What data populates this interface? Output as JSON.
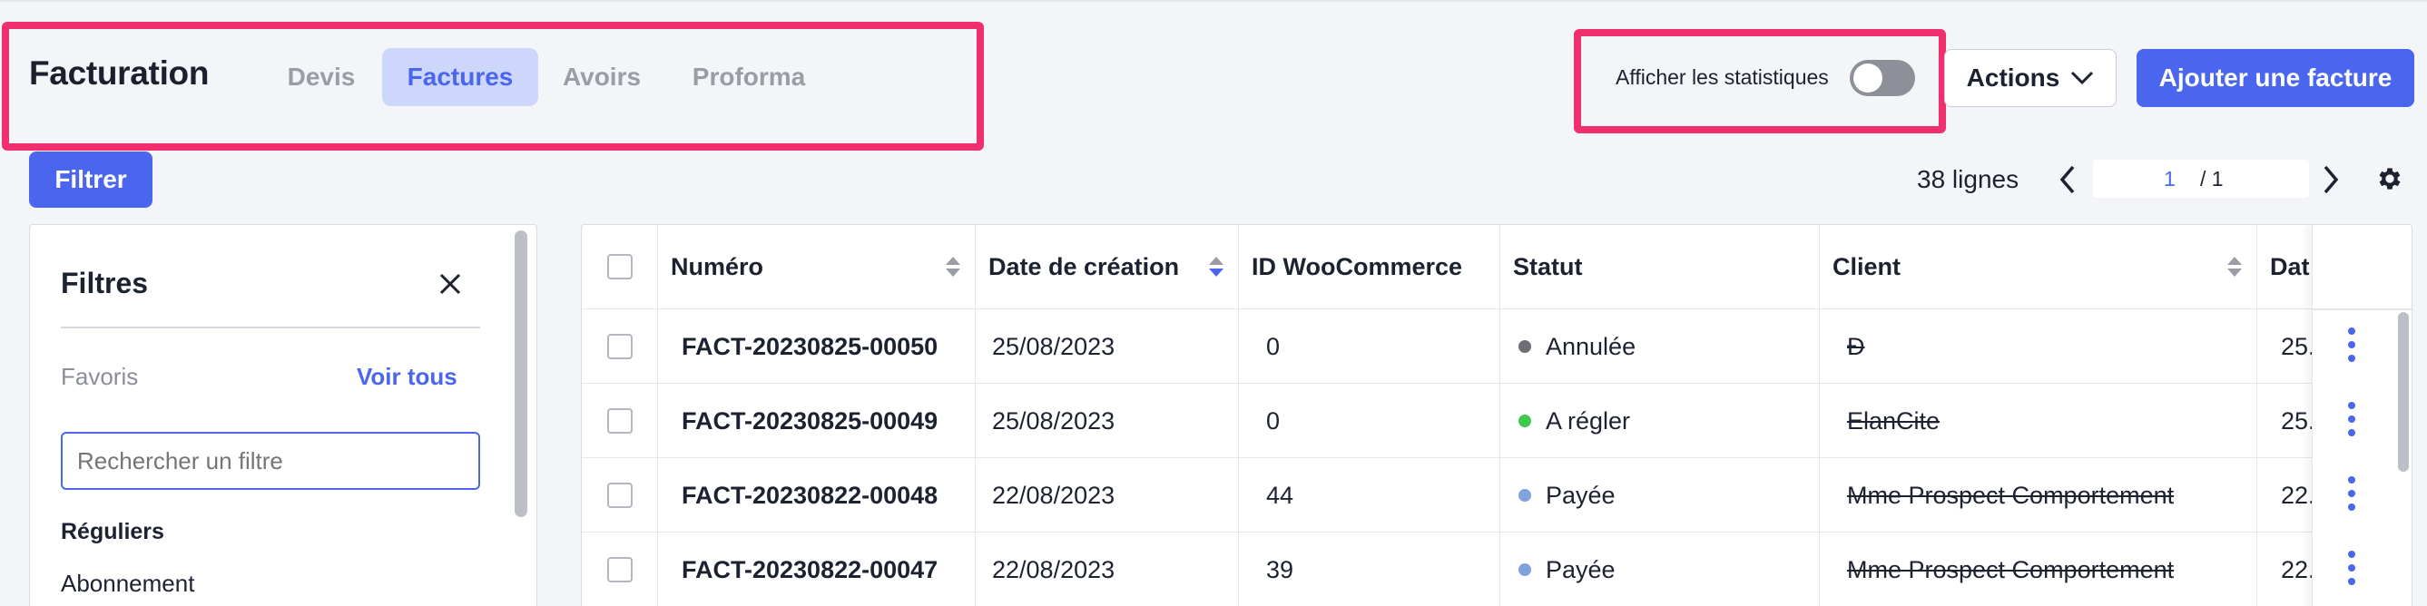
{
  "header": {
    "title": "Facturation",
    "tabs": [
      {
        "label": "Devis",
        "active": false
      },
      {
        "label": "Factures",
        "active": true
      },
      {
        "label": "Avoirs",
        "active": false
      },
      {
        "label": "Proforma",
        "active": false
      }
    ],
    "stats_label": "Afficher les statistiques",
    "stats_toggle_on": false,
    "actions_label": "Actions",
    "add_label": "Ajouter une facture"
  },
  "toolbar": {
    "filter_label": "Filtrer",
    "row_count": "38 lignes",
    "current_page": "1",
    "total_pages": "/ 1"
  },
  "filters": {
    "title": "Filtres",
    "favorites_label": "Favoris",
    "see_all_label": "Voir tous",
    "search_placeholder": "Rechercher un filtre",
    "regular_label": "Réguliers",
    "first_item": "Abonnement"
  },
  "table": {
    "columns": [
      "Numéro",
      "Date de création",
      "ID WooCommerce",
      "Statut",
      "Client",
      "Dat"
    ],
    "rows": [
      {
        "numero": "FACT-20230825-00050",
        "date": "25/08/2023",
        "woo": "0",
        "statut": "Annulée",
        "client": "Ð",
        "date2": "25."
      },
      {
        "numero": "FACT-20230825-00049",
        "date": "25/08/2023",
        "woo": "0",
        "statut": "A régler",
        "client": "ElanCite",
        "date2": "25."
      },
      {
        "numero": "FACT-20230822-00048",
        "date": "22/08/2023",
        "woo": "44",
        "statut": "Payée",
        "client": "Mme Prospect Comportement",
        "date2": "22."
      },
      {
        "numero": "FACT-20230822-00047",
        "date": "22/08/2023",
        "woo": "39",
        "statut": "Payée",
        "client": "Mme Prospect Comportement",
        "date2": "22."
      }
    ]
  },
  "colors": {
    "accent": "#4a66ee",
    "highlight": "#f0306e",
    "status_cancelled": "#6e6f74",
    "status_pending": "#3ec94a",
    "status_paid": "#7fa3dc"
  }
}
